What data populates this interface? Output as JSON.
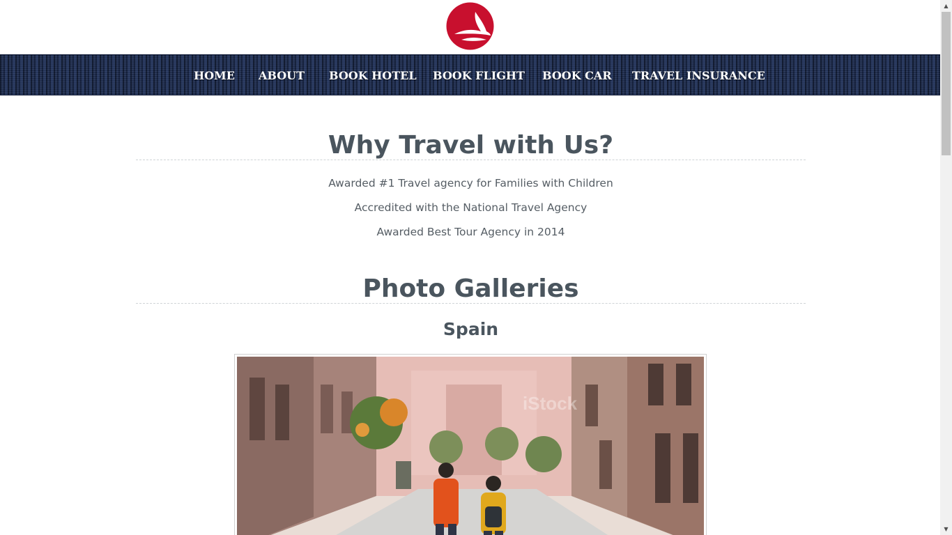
{
  "brand": {
    "logo_icon": "tail-logo-icon",
    "logo_color": "#c8102e"
  },
  "nav": {
    "items": [
      {
        "label": "HOME"
      },
      {
        "label": "ABOUT"
      },
      {
        "label": "BOOK HOTEL"
      },
      {
        "label": "BOOK FLIGHT"
      },
      {
        "label": "BOOK CAR"
      },
      {
        "label": "TRAVEL INSURANCE"
      }
    ]
  },
  "why": {
    "title": "Why Travel with Us?",
    "features": [
      "Awarded #1 Travel agency for Families with Children",
      "Accredited with the National Travel Agency",
      "Awarded Best Tour Agency in 2014"
    ]
  },
  "galleries": {
    "title": "Photo Galleries",
    "items": [
      {
        "name": "Spain",
        "watermark": "iStock"
      }
    ]
  }
}
